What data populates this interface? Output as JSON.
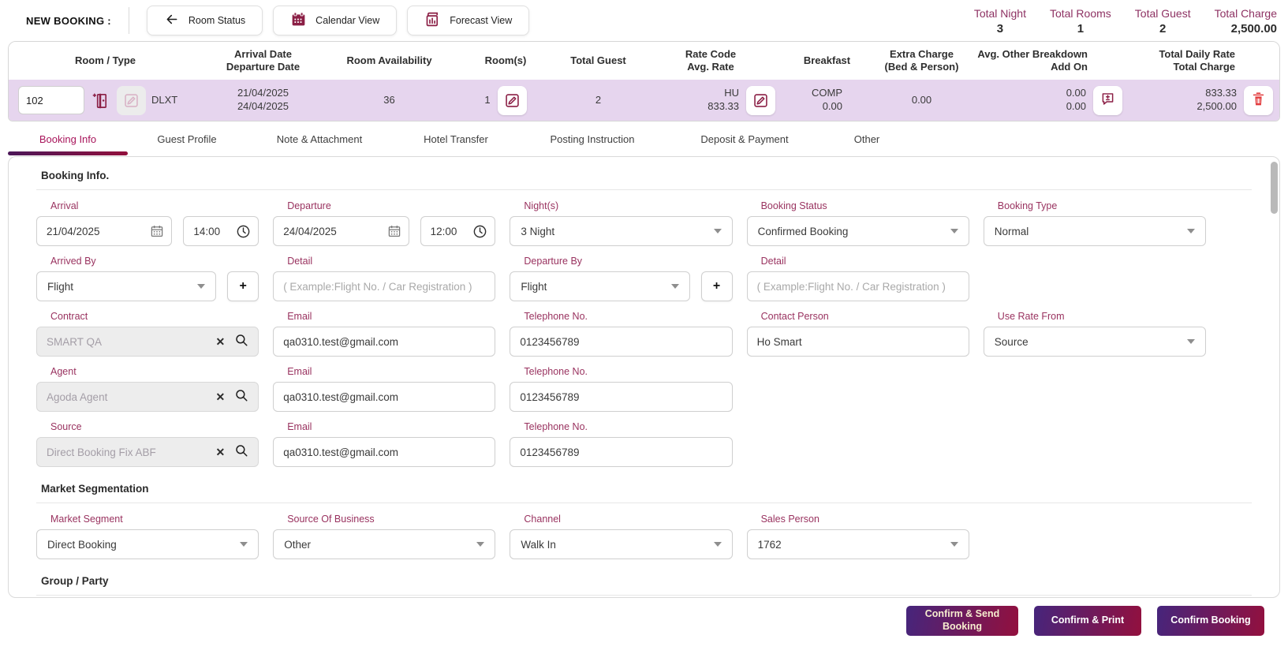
{
  "topbar": {
    "title": "NEW BOOKING :",
    "buttons": [
      {
        "label": "Room Status",
        "icon": "back-arrow"
      },
      {
        "label": "Calendar View",
        "icon": "calendar"
      },
      {
        "label": "Forecast View",
        "icon": "forecast-chart"
      }
    ],
    "stats": [
      {
        "label": "Total Night",
        "value": "3"
      },
      {
        "label": "Total Rooms",
        "value": "1"
      },
      {
        "label": "Total Guest",
        "value": "2"
      },
      {
        "label": "Total Charge",
        "value": "2,500.00"
      }
    ]
  },
  "room_table": {
    "headers": [
      {
        "line1": "Room / Type"
      },
      {
        "line1": "Arrival Date",
        "line2": "Departure Date"
      },
      {
        "line1": "Room Availability"
      },
      {
        "line1": "Room(s)"
      },
      {
        "line1": "Total Guest"
      },
      {
        "line1": "Rate Code",
        "line2": "Avg. Rate"
      },
      {
        "line1": "Breakfast"
      },
      {
        "line1": "Extra Charge",
        "line2": "(Bed & Person)"
      },
      {
        "line1": "Avg. Other Breakdown",
        "line2": "Add On"
      },
      {
        "line1": "Total Daily Rate",
        "line2": "Total Charge"
      }
    ],
    "row": {
      "room_no": "102",
      "room_type": "DLXT",
      "arrival_date": "21/04/2025",
      "departure_date": "24/04/2025",
      "availability": "36",
      "rooms": "1",
      "total_guest": "2",
      "rate_code": "HU",
      "avg_rate": "833.33",
      "breakfast_code": "COMP",
      "breakfast_amount": "0.00",
      "extra_charge": "0.00",
      "avg_other_breakdown": "0.00",
      "add_on": "0.00",
      "total_daily_rate": "833.33",
      "total_charge": "2,500.00"
    }
  },
  "tabs": [
    {
      "label": "Booking Info",
      "active": true
    },
    {
      "label": "Guest Profile",
      "active": false
    },
    {
      "label": "Note & Attachment",
      "active": false
    },
    {
      "label": "Hotel Transfer",
      "active": false
    },
    {
      "label": "Posting Instruction",
      "active": false
    },
    {
      "label": "Deposit & Payment",
      "active": false
    },
    {
      "label": "Other",
      "active": false
    }
  ],
  "booking_info": {
    "section_title": "Booking Info.",
    "arrival": {
      "label": "Arrival",
      "date": "21/04/2025",
      "time": "14:00"
    },
    "departure": {
      "label": "Departure",
      "date": "24/04/2025",
      "time": "12:00"
    },
    "nights": {
      "label": "Night(s)",
      "value": "3 Night"
    },
    "booking_status": {
      "label": "Booking Status",
      "value": "Confirmed Booking"
    },
    "booking_type": {
      "label": "Booking Type",
      "value": "Normal"
    },
    "arrived_by": {
      "label": "Arrived By",
      "value": "Flight"
    },
    "arrival_detail": {
      "label": "Detail",
      "placeholder": "( Example:Flight No. / Car Registration )"
    },
    "departure_by": {
      "label": "Departure By",
      "value": "Flight"
    },
    "departure_detail": {
      "label": "Detail",
      "placeholder": "( Example:Flight No. / Car Registration )"
    },
    "contract": {
      "label": "Contract",
      "value": "SMART QA",
      "email_label": "Email",
      "email": "qa0310.test@gmail.com",
      "phone_label": "Telephone No.",
      "phone": "0123456789"
    },
    "contact_person": {
      "label": "Contact Person",
      "value": "Ho Smart"
    },
    "use_rate_from": {
      "label": "Use Rate From",
      "value": "Source"
    },
    "agent": {
      "label": "Agent",
      "value": "Agoda Agent",
      "email_label": "Email",
      "email": "qa0310.test@gmail.com",
      "phone_label": "Telephone No.",
      "phone": "0123456789"
    },
    "source": {
      "label": "Source",
      "value": "Direct Booking Fix ABF",
      "email_label": "Email",
      "email": "qa0310.test@gmail.com",
      "phone_label": "Telephone No.",
      "phone": "0123456789"
    }
  },
  "market_segmentation": {
    "section_title": "Market Segmentation",
    "market_segment": {
      "label": "Market Segment",
      "value": "Direct Booking"
    },
    "source_of_business": {
      "label": "Source Of Business",
      "value": "Other"
    },
    "channel": {
      "label": "Channel",
      "value": "Walk In"
    },
    "sales_person": {
      "label": "Sales Person",
      "value": "1762"
    }
  },
  "group_party": {
    "section_title": "Group / Party"
  },
  "footer": {
    "buttons": [
      {
        "label": "Confirm & Send Booking"
      },
      {
        "label": "Confirm & Print"
      },
      {
        "label": "Confirm Booking"
      }
    ]
  },
  "icons": {
    "clear": "✕",
    "add": "+"
  },
  "colors": {
    "accent_label": "#99325f",
    "icon_maroon": "#8b1f45",
    "row_highlight": "#e6d5ee",
    "button_gradient_start": "#46257c",
    "button_gradient_end": "#93103e",
    "trash_red": "#e23b3d",
    "active_tab": "#a8155b"
  }
}
